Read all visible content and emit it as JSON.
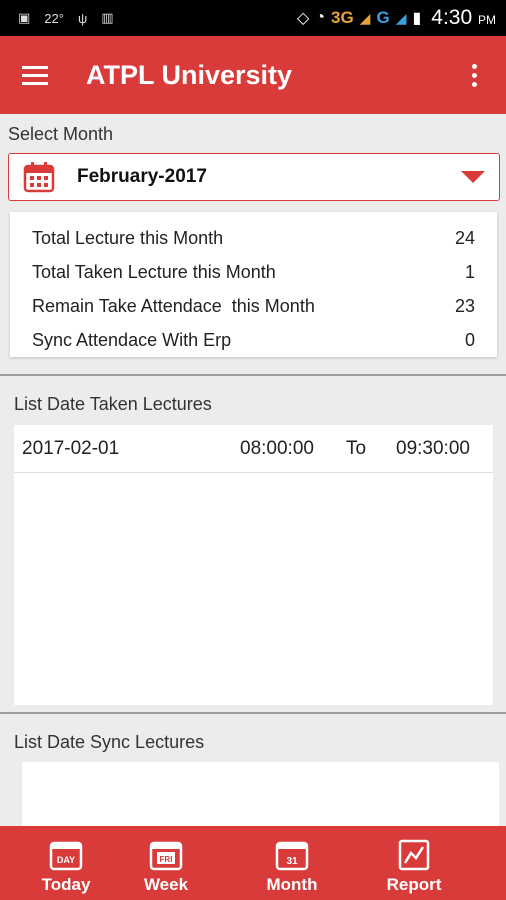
{
  "status_bar": {
    "temperature": "22°",
    "network_3g": "3G",
    "network_g": "G",
    "time": "4:30",
    "ampm": "PM"
  },
  "app_bar": {
    "title": "ATPL University"
  },
  "month_selector": {
    "label": "Select Month",
    "value": "February-2017"
  },
  "stats": [
    {
      "label": "Total Lecture this Month",
      "value": "24"
    },
    {
      "label": "Total Taken Lecture this Month",
      "value": "1"
    },
    {
      "label": "Remain Take Attendace  this Month",
      "value": "23"
    },
    {
      "label": "Sync Attendace With Erp",
      "value": "0"
    }
  ],
  "taken_lectures": {
    "heading": "List Date Taken Lectures",
    "rows": [
      {
        "date": "2017-02-01",
        "start": "08:00:00",
        "to": "To",
        "end": "09:30:00"
      }
    ]
  },
  "sync_lectures": {
    "heading": "List Date Sync Lectures"
  },
  "bottom_nav": [
    {
      "label": "Today",
      "icon": "DAY"
    },
    {
      "label": "Week",
      "icon": "FRI"
    },
    {
      "label": "Month",
      "icon": "31"
    },
    {
      "label": "Report",
      "icon": "chart"
    }
  ],
  "colors": {
    "primary": "#d93a3a",
    "background": "#ececec",
    "status_bar": "#000000"
  }
}
